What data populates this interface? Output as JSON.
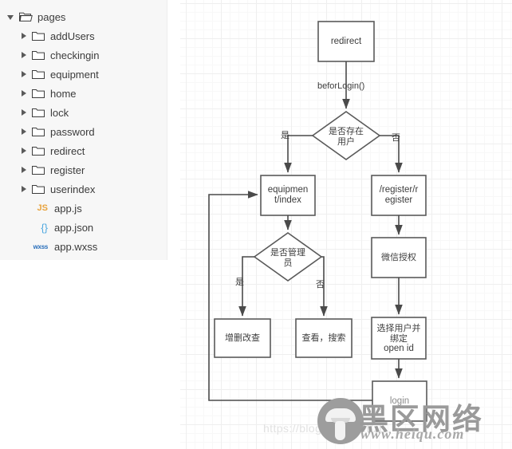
{
  "explorer": {
    "name": "project-file-tree",
    "rows": [
      {
        "label": "pages",
        "kind": "folder-open",
        "depth": 0,
        "expanded": true,
        "icon": "folder-open-icon"
      },
      {
        "label": "addUsers",
        "kind": "folder",
        "depth": 1,
        "expanded": false,
        "icon": "folder-icon"
      },
      {
        "label": "checkingin",
        "kind": "folder",
        "depth": 1,
        "expanded": false,
        "icon": "folder-icon"
      },
      {
        "label": "equipment",
        "kind": "folder",
        "depth": 1,
        "expanded": false,
        "icon": "folder-icon"
      },
      {
        "label": "home",
        "kind": "folder",
        "depth": 1,
        "expanded": false,
        "icon": "folder-icon"
      },
      {
        "label": "lock",
        "kind": "folder",
        "depth": 1,
        "expanded": false,
        "icon": "folder-icon"
      },
      {
        "label": "password",
        "kind": "folder",
        "depth": 1,
        "expanded": false,
        "icon": "folder-icon"
      },
      {
        "label": "redirect",
        "kind": "folder",
        "depth": 1,
        "expanded": false,
        "icon": "folder-icon"
      },
      {
        "label": "register",
        "kind": "folder",
        "depth": 1,
        "expanded": false,
        "icon": "folder-icon"
      },
      {
        "label": "userindex",
        "kind": "folder",
        "depth": 1,
        "expanded": false,
        "icon": "folder-icon"
      },
      {
        "label": "app.js",
        "kind": "file",
        "depth": 1,
        "icon": "js-file-icon",
        "badge": "JS"
      },
      {
        "label": "app.json",
        "kind": "file",
        "depth": 1,
        "icon": "json-file-icon",
        "badge": "{}"
      },
      {
        "label": "app.wxss",
        "kind": "file",
        "depth": 1,
        "icon": "wxss-file-icon",
        "badge": "wxss"
      }
    ]
  },
  "flowchart": {
    "nodes": {
      "redirect": {
        "label": "redirect"
      },
      "has_user": {
        "label": "是否存在\n用户"
      },
      "equipment": {
        "label": "equipmen\nt/index"
      },
      "register": {
        "label": "/register/r\negister"
      },
      "is_admin": {
        "label": "是否管理\n员"
      },
      "wechat_auth": {
        "label": "微信授权"
      },
      "bind_open_id": {
        "label": "选择用户并\n绑定\nopen id"
      },
      "crud": {
        "label": "增删改查"
      },
      "view_search": {
        "label": "查看，搜索"
      },
      "login": {
        "label": "login"
      }
    },
    "edge_labels": {
      "before_login": "beforLogin()",
      "has_user_yes": "是",
      "has_user_no": "否",
      "is_admin_yes": "是",
      "is_admin_no": "否"
    }
  },
  "watermarks": {
    "csdn_url": "https://blog.csdn.net/zh",
    "brand_cn": "黑区网络",
    "brand_url": "www.heiqu.com"
  }
}
